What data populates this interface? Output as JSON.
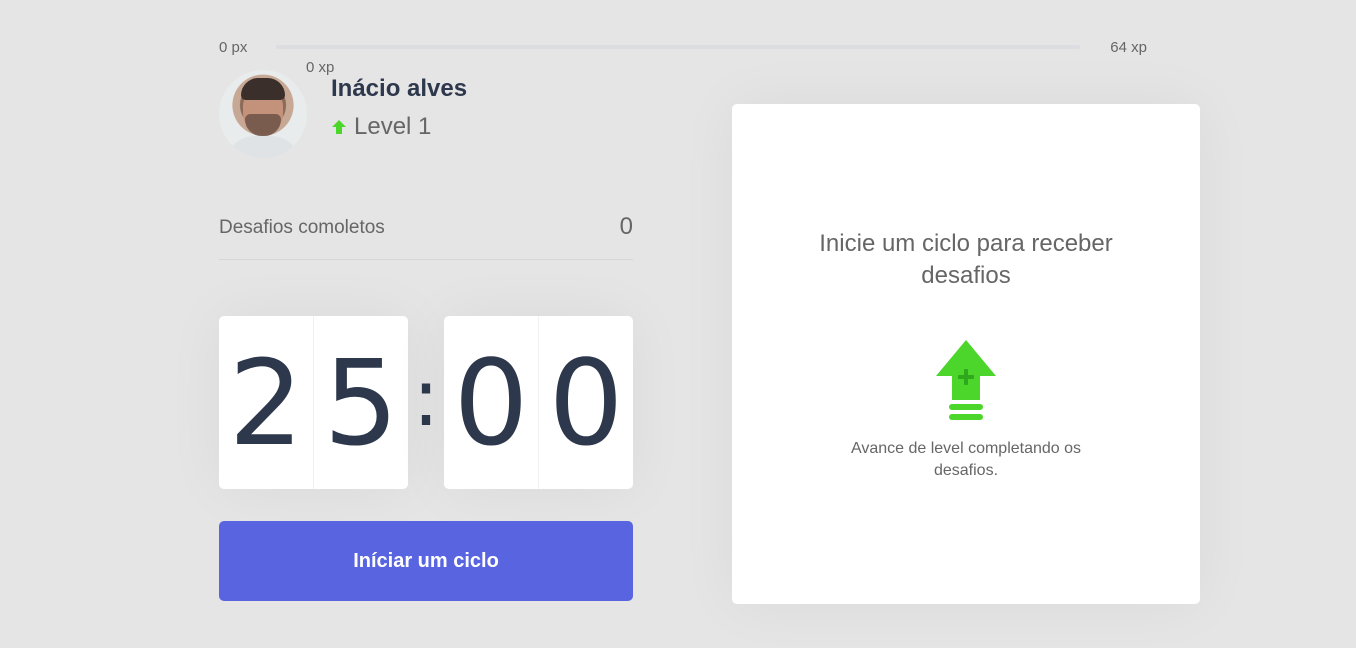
{
  "xp": {
    "min_label": "0 px",
    "max_label": "64 xp",
    "current_label": "0 xp",
    "progress_percent": 0
  },
  "profile": {
    "name": "Inácio alves",
    "level_label": "Level 1"
  },
  "stats": {
    "completed_label": "Desafios comoletos",
    "completed_count": "0"
  },
  "countdown": {
    "minute_left": "2",
    "minute_right": "5",
    "separator": ":",
    "second_left": "0",
    "second_right": "0"
  },
  "actions": {
    "start_cycle_label": "Iníciar um ciclo"
  },
  "challenge": {
    "title": "Inicie um ciclo para receber desafios",
    "description": "Avance de level completando os desafios.",
    "icon": "level-up-icon"
  },
  "colors": {
    "background": "#e5e5e5",
    "accent_blue": "#5965e0",
    "level_green": "#4cd62b",
    "title_dark": "#2e384d",
    "text_gray": "#666666"
  }
}
